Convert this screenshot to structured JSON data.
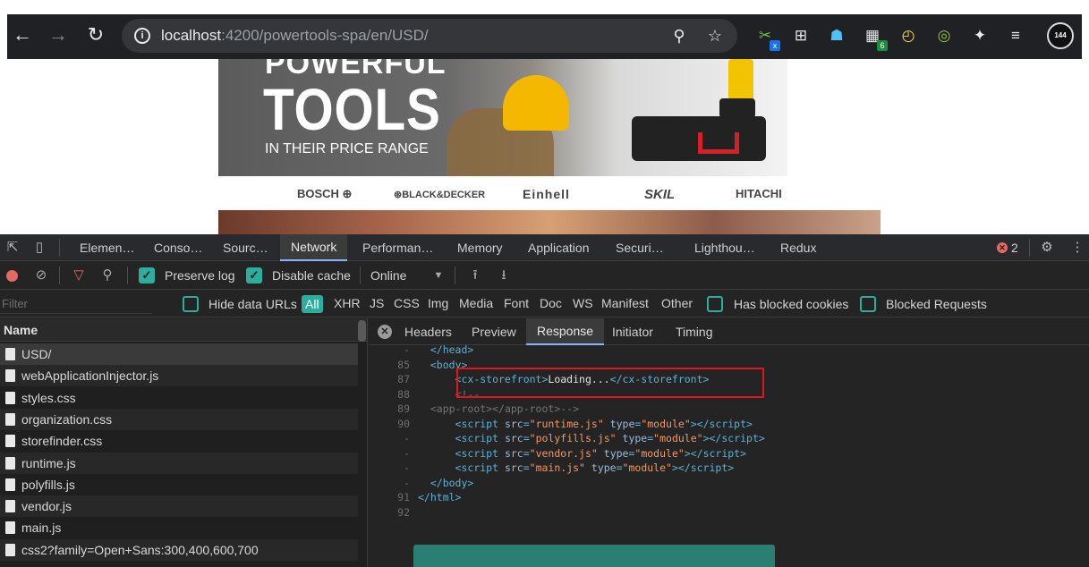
{
  "browser": {
    "url_host": "localhost",
    "url_path": ":4200/powertools-spa/en/USD/",
    "info_icon": "i",
    "extensions": [
      {
        "name": "extension-x-icon",
        "badge": "x",
        "color": "#1a73e8"
      },
      {
        "name": "extension-globe-icon",
        "badge": ""
      },
      {
        "name": "extension-rocket-icon",
        "badge": ""
      },
      {
        "name": "extension-sheet-icon",
        "badge": "6",
        "color": "#1e8e3e"
      },
      {
        "name": "extension-alarm-icon",
        "badge": ""
      },
      {
        "name": "extension-target-icon",
        "badge": ""
      },
      {
        "name": "puzzle-icon",
        "badge": ""
      },
      {
        "name": "media-queue-icon",
        "badge": ""
      }
    ],
    "profile_label": "144"
  },
  "page": {
    "hero_top": "POWERFUL",
    "hero_title": "TOOLS",
    "hero_sub": "IN THEIR PRICE RANGE",
    "brands": [
      "BOSCH ⊕",
      "⊛BLACK&DECKER",
      "Einhell",
      "SKIL",
      "HITACHI"
    ]
  },
  "devtools": {
    "tabs": [
      "Elemen…",
      "Conso…",
      "Sourc…",
      "Network",
      "Performan…",
      "Memory",
      "Application",
      "Securi…",
      "Lighthou…",
      "Redux"
    ],
    "active_tab": "Network",
    "error_count": "2",
    "toolbar": {
      "preserve_log": "Preserve log",
      "disable_cache": "Disable cache",
      "throttle": "Online",
      "preserve_checked": true,
      "disable_checked": true
    },
    "filter": {
      "placeholder": "Filter",
      "hide_data_urls": "Hide data URLs",
      "types": [
        "All",
        "XHR",
        "JS",
        "CSS",
        "Img",
        "Media",
        "Font",
        "Doc",
        "WS",
        "Manifest",
        "Other"
      ],
      "active_type": "All",
      "has_blocked_cookies": "Has blocked cookies",
      "blocked_requests": "Blocked Requests"
    },
    "requests": {
      "header": "Name",
      "rows": [
        "USD/",
        "webApplicationInjector.js",
        "styles.css",
        "organization.css",
        "storefinder.css",
        "runtime.js",
        "polyfills.js",
        "vendor.js",
        "main.js",
        "css2?family=Open+Sans:300,400,600,700"
      ]
    },
    "detail": {
      "tabs": [
        "Headers",
        "Preview",
        "Response",
        "Initiator",
        "Timing"
      ],
      "active_tab": "Response",
      "code_lines": [
        {
          "ln": "-",
          "html": "<span class=\"tag\">&lt;/head&gt;</span>",
          "indent": "  "
        },
        {
          "ln": "85",
          "html": "<span class=\"tag\">&lt;body&gt;</span>",
          "indent": "  "
        },
        {
          "ln": "87",
          "html": "<span class=\"tag\">&lt;cx-storefront&gt;</span><span class=\"txt\">Loading...</span><span class=\"tag\">&lt;/cx-storefront&gt;</span>",
          "indent": "      "
        },
        {
          "ln": "88",
          "html": "<span class=\"cmt\">&lt;!--</span>",
          "indent": "      "
        },
        {
          "ln": "89",
          "html": "<span class=\"cmt\">&lt;app-root&gt;&lt;/app-root&gt;--&gt;</span>",
          "indent": "  "
        },
        {
          "ln": "90",
          "html": "<span class=\"tag\">&lt;script </span><span class=\"attr\">src</span>=<span class=\"val\">\"runtime.js\"</span> <span class=\"attr\">type</span>=<span class=\"val\">\"module\"</span><span class=\"tag\">&gt;&lt;/script&gt;</span>",
          "indent": "      "
        },
        {
          "ln": "-",
          "html": "<span class=\"tag\">&lt;script </span><span class=\"attr\">src</span>=<span class=\"val\">\"polyfills.js\"</span> <span class=\"attr\">type</span>=<span class=\"val\">\"module\"</span><span class=\"tag\">&gt;&lt;/script&gt;</span>",
          "indent": "      "
        },
        {
          "ln": "-",
          "html": "<span class=\"tag\">&lt;script </span><span class=\"attr\">src</span>=<span class=\"val\">\"vendor.js\"</span> <span class=\"attr\">type</span>=<span class=\"val\">\"module\"</span><span class=\"tag\">&gt;&lt;/script&gt;</span>",
          "indent": "      "
        },
        {
          "ln": "-",
          "html": "<span class=\"tag\">&lt;script </span><span class=\"attr\">src</span>=<span class=\"val\">\"main.js\"</span> <span class=\"attr\">type</span>=<span class=\"val\">\"module\"</span><span class=\"tag\">&gt;&lt;/script&gt;</span>",
          "indent": "      "
        },
        {
          "ln": "-",
          "html": "<span class=\"tag\">&lt;/body&gt;</span>",
          "indent": "  "
        },
        {
          "ln": "91",
          "html": "<span class=\"tag\">&lt;/html&gt;</span>",
          "indent": ""
        },
        {
          "ln": "92",
          "html": "",
          "indent": ""
        }
      ]
    }
  },
  "colors": {
    "accent_teal": "#2dad9b",
    "highlight_red": "#e0161c",
    "error_red": "#e46962"
  }
}
